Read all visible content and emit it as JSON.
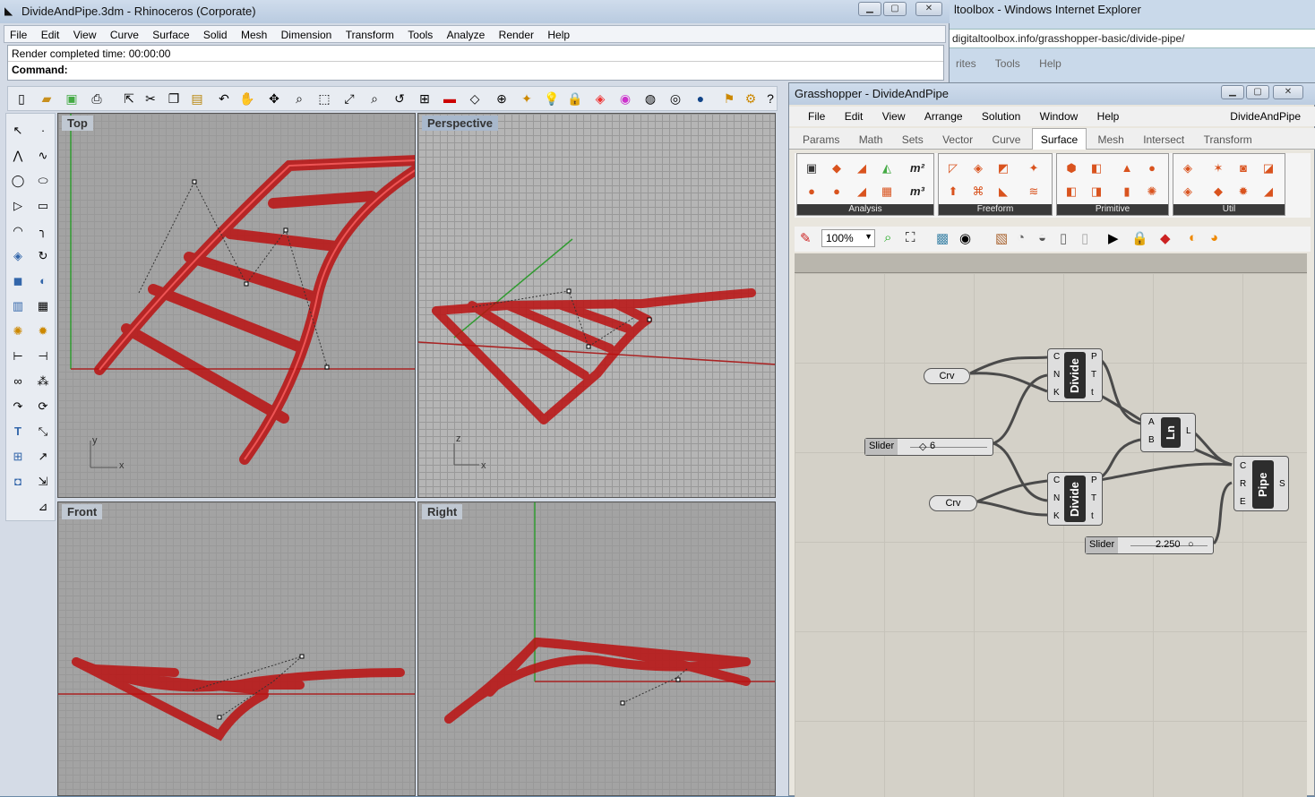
{
  "ie": {
    "title": "ltoolbox - Windows Internet Explorer",
    "address": "digitaltoolbox.info/grasshopper-basic/divide-pipe/",
    "menu": [
      "rites",
      "Tools",
      "Help"
    ]
  },
  "rhino": {
    "title": "DivideAndPipe.3dm - Rhinoceros (Corporate)",
    "menu": [
      "File",
      "Edit",
      "View",
      "Curve",
      "Surface",
      "Solid",
      "Mesh",
      "Dimension",
      "Transform",
      "Tools",
      "Analyze",
      "Render",
      "Help"
    ],
    "status_line": "Render completed time: 00:00:00",
    "command_label": "Command:",
    "viewports": {
      "top": "Top",
      "perspective": "Perspective",
      "front": "Front",
      "right": "Right"
    },
    "axis": {
      "x": "x",
      "y": "y",
      "z": "z"
    }
  },
  "gh": {
    "title": "Grasshopper - DivideAndPipe",
    "menu": [
      "File",
      "Edit",
      "View",
      "Arrange",
      "Solution",
      "Window",
      "Help"
    ],
    "doc_name": "DivideAndPipe",
    "tabs": [
      "Params",
      "Math",
      "Sets",
      "Vector",
      "Curve",
      "Surface",
      "Mesh",
      "Intersect",
      "Transform"
    ],
    "active_tab": "Surface",
    "ribbon_groups": [
      "Analysis",
      "Freeform",
      "Primitive",
      "Util"
    ],
    "zoom": "100%",
    "canvas": {
      "crv1": "Crv",
      "crv2": "Crv",
      "slider1_label": "Slider",
      "slider1_value": "6",
      "slider2_label": "Slider",
      "slider2_value": "2.250",
      "divide": "Divide",
      "divide_in": [
        "C",
        "N",
        "K"
      ],
      "divide_out": [
        "P",
        "T",
        "t"
      ],
      "ln": "Ln",
      "ln_in": [
        "A",
        "B"
      ],
      "ln_out": "L",
      "pipe": "Pipe",
      "pipe_in": [
        "C",
        "R",
        "E"
      ],
      "pipe_out": "S"
    }
  }
}
